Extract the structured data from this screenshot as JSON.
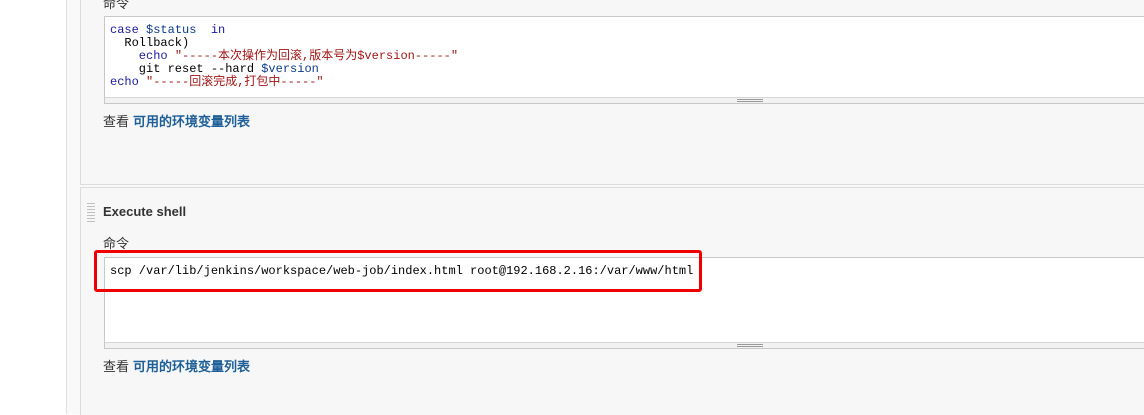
{
  "section1": {
    "field_label": "命令",
    "code_lines": [
      [
        {
          "t": "case ",
          "c": "kw"
        },
        {
          "t": "$status",
          "c": "var"
        },
        {
          "t": "  in",
          "c": "kw"
        }
      ],
      [
        {
          "t": "  Rollback)",
          "c": ""
        }
      ],
      [
        {
          "t": "    echo ",
          "c": "kw"
        },
        {
          "t": "\"-----本次操作为回滚,版本号为",
          "c": "str"
        },
        {
          "t": "$version",
          "c": "str"
        },
        {
          "t": "-----\"",
          "c": "str"
        }
      ],
      [
        {
          "t": "    git reset --hard ",
          "c": ""
        },
        {
          "t": "$version",
          "c": "var"
        }
      ],
      [
        {
          "t": "echo ",
          "c": "kw"
        },
        {
          "t": "\"-----回滚完成,打包中-----\"",
          "c": "str"
        }
      ]
    ],
    "help_prefix": "查看",
    "help_link": "可用的环境变量列表"
  },
  "section2": {
    "title": "Execute shell",
    "field_label": "命令",
    "command": "scp /var/lib/jenkins/workspace/web-job/index.html root@192.168.2.16:/var/www/html",
    "help_prefix": "查看",
    "help_link": "可用的环境变量列表"
  },
  "colors": {
    "highlight": "#ee0000",
    "link": "#1e5f99"
  }
}
